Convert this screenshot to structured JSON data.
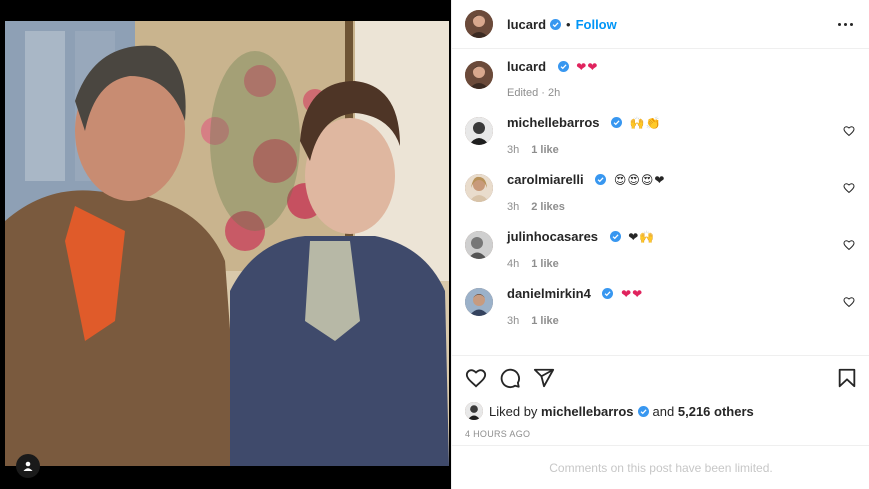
{
  "post": {
    "author": "lucard",
    "follow_label": "Follow",
    "dot": "•",
    "caption_emoji": "❤❤",
    "caption_meta": "Edited · 2h"
  },
  "comments": [
    {
      "user": "michellebarros",
      "emoji": "🙌👏",
      "time": "3h",
      "likes": "1 like"
    },
    {
      "user": "carolmiarelli",
      "emoji": "😍😍😍❤",
      "time": "3h",
      "likes": "2 likes"
    },
    {
      "user": "julinhocasares",
      "emoji": "❤🙌",
      "time": "4h",
      "likes": "1 like"
    },
    {
      "user": "danielmirkin4",
      "emoji": "❤❤",
      "time": "3h",
      "likes": "1 like"
    }
  ],
  "likes_line": {
    "prefix": "Liked by",
    "user": "michellebarros",
    "mid": "and",
    "count": "5,216 others"
  },
  "timestamp": "4 HOURS AGO",
  "comments_limited": "Comments on this post have been limited.",
  "icons": {
    "like": "heart-icon",
    "comment": "comment-icon",
    "share": "share-icon",
    "save": "bookmark-icon",
    "more": "more-options-icon",
    "verified": "verified-badge-icon",
    "tag": "user-tag-icon"
  },
  "colors": {
    "link_blue": "#0095f6",
    "verified_blue": "#3897f0",
    "muted": "#8e8e8e",
    "heart_red": "#e0245e"
  }
}
